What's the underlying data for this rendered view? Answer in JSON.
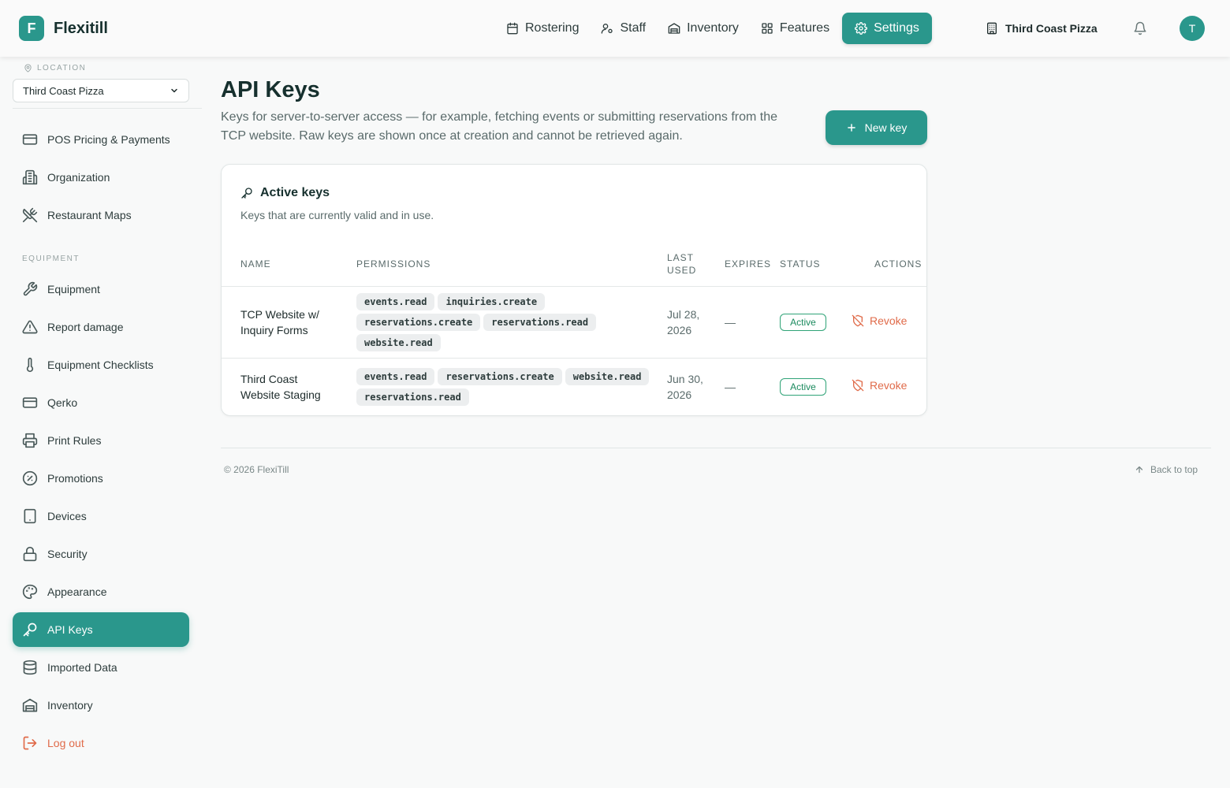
{
  "app": {
    "logo_letter": "F",
    "name": "Flexitill"
  },
  "nav": {
    "items": [
      {
        "label": "Rostering",
        "icon": "calendar-icon"
      },
      {
        "label": "Staff",
        "icon": "user-icon"
      },
      {
        "label": "Inventory",
        "icon": "warehouse-icon"
      },
      {
        "label": "Features",
        "icon": "grid-icon"
      },
      {
        "label": "Settings",
        "icon": "gear-icon",
        "active": true
      }
    ],
    "location": "Third Coast Pizza",
    "avatar_letter": "T"
  },
  "sidebar": {
    "location_label": "LOCATION",
    "location_value": "Third Coast Pizza",
    "items_top": [
      {
        "label": "POS Pricing & Payments",
        "icon": "credit-card-icon"
      },
      {
        "label": "Organization",
        "icon": "building-icon"
      },
      {
        "label": "Restaurant Maps",
        "icon": "utensils-crossed-icon"
      }
    ],
    "section_label": "EQUIPMENT",
    "items": [
      {
        "label": "Equipment",
        "icon": "wrench-icon"
      },
      {
        "label": "Report damage",
        "icon": "warning-icon"
      },
      {
        "label": "Equipment Checklists",
        "icon": "thermometer-icon"
      },
      {
        "label": "Qerko",
        "icon": "credit-card-icon"
      },
      {
        "label": "Print Rules",
        "icon": "printer-icon"
      },
      {
        "label": "Promotions",
        "icon": "badge-percent-icon"
      },
      {
        "label": "Devices",
        "icon": "tablet-icon"
      },
      {
        "label": "Security",
        "icon": "lock-icon"
      },
      {
        "label": "Appearance",
        "icon": "palette-icon"
      },
      {
        "label": "API Keys",
        "icon": "key-icon",
        "active": true
      },
      {
        "label": "Imported Data",
        "icon": "database-icon"
      },
      {
        "label": "Inventory",
        "icon": "warehouse-icon"
      }
    ],
    "logout_label": "Log out"
  },
  "page": {
    "title": "API Keys",
    "description": "Keys for server-to-server access — for example, fetching events or submitting reservations from the TCP website. Raw keys are shown once at creation and cannot be retrieved again.",
    "new_key_label": "New key"
  },
  "card": {
    "title": "Active keys",
    "subtitle": "Keys that are currently valid and in use.",
    "columns": {
      "name": "NAME",
      "permissions": "PERMISSIONS",
      "last_used_1": "LAST",
      "last_used_2": "USED",
      "expires": "EXPIRES",
      "status": "STATUS",
      "actions": "ACTIONS"
    },
    "rows": [
      {
        "name_1": "TCP Website w/",
        "name_2": "Inquiry Forms",
        "permissions": [
          "events.read",
          "inquiries.create",
          "reservations.create",
          "reservations.read",
          "website.read"
        ],
        "last_used_1": "Jul 28,",
        "last_used_2": "2026",
        "expires": "—",
        "status": "Active",
        "action": "Revoke"
      },
      {
        "name_1": "Third Coast",
        "name_2": "Website Staging",
        "permissions": [
          "events.read",
          "reservations.create",
          "website.read",
          "reservations.read"
        ],
        "last_used_1": "Jun 30,",
        "last_used_2": "2026",
        "expires": "—",
        "status": "Active",
        "action": "Revoke"
      }
    ]
  },
  "footer": {
    "copyright": "© 2026 FlexiTill",
    "back_to_top": "Back to top"
  },
  "colors": {
    "accent": "#2a978c",
    "danger": "#e06b4a",
    "success": "#1b8a5e"
  }
}
